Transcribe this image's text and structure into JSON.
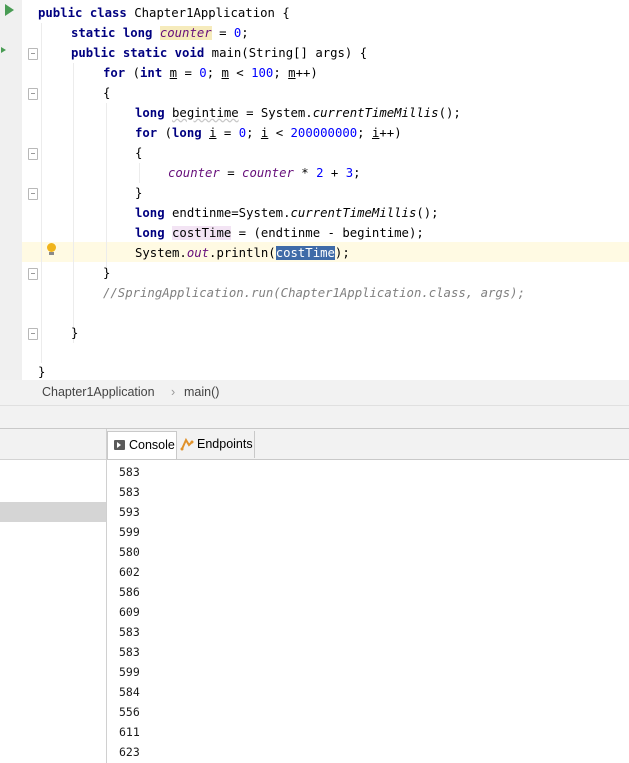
{
  "editor": {
    "lines": {
      "l1_a": "public class ",
      "l1_b": "Chapter1Application {",
      "l2_kw": "static long ",
      "l2_var": "counter",
      "l2_rest": " = ",
      "l2_num": "0",
      "l2_end": ";",
      "l3_kw": "public static void ",
      "l3_rest": "main(String[] args) {",
      "l4_kw": "for ",
      "l4_a": "(",
      "l4_kw2": "int ",
      "l4_m1": "m",
      "l4_b": " = ",
      "l4_n1": "0",
      "l4_c": "; ",
      "l4_m2": "m",
      "l4_d": " < ",
      "l4_n2": "100",
      "l4_e": "; ",
      "l4_m3": "m",
      "l4_f": "++)",
      "l5": "{",
      "l6_kw": "long ",
      "l6_var": "begintime",
      "l6_a": " = System.",
      "l6_m": "currentTimeMillis",
      "l6_b": "();",
      "l7_kw": "for ",
      "l7_a": "(",
      "l7_kw2": "long ",
      "l7_i1": "i",
      "l7_b": " = ",
      "l7_n1": "0",
      "l7_c": "; ",
      "l7_i2": "i",
      "l7_d": " < ",
      "l7_n2": "200000000",
      "l7_e": "; ",
      "l7_i3": "i",
      "l7_f": "++)",
      "l8": "{",
      "l9_f1": "counter",
      "l9_a": " = ",
      "l9_f2": "counter",
      "l9_b": " * ",
      "l9_n1": "2",
      "l9_c": " + ",
      "l9_n2": "3",
      "l9_d": ";",
      "l10": "}",
      "l11_kw": "long ",
      "l11_a": "endtinme=System.",
      "l11_m": "currentTimeMillis",
      "l11_b": "();",
      "l12_kw": "long ",
      "l12_var": "costTime",
      "l12_a": " = (endtinme - begintime);",
      "l13_a": "System.",
      "l13_out": "out",
      "l13_b": ".println(",
      "l13_sel": "costTime",
      "l13_c": ");",
      "l14": "}",
      "l15": "//SpringApplication.run(Chapter1Application.class, args);",
      "l17": "}",
      "l19": "}"
    }
  },
  "breadcrumb": {
    "class_name": "Chapter1Application",
    "separator": "›",
    "method": "main()"
  },
  "tabs": {
    "console": "Console",
    "endpoints": "Endpoints"
  },
  "console_output": [
    "583",
    "583",
    "593",
    "599",
    "580",
    "602",
    "586",
    "609",
    "583",
    "583",
    "599",
    "584",
    "556",
    "611",
    "623"
  ],
  "colors": {
    "keyword": "#000080",
    "number": "#0000ff",
    "field": "#660e7a",
    "comment": "#808080",
    "selection": "#3f6ba8",
    "current_line": "#fffae3"
  }
}
